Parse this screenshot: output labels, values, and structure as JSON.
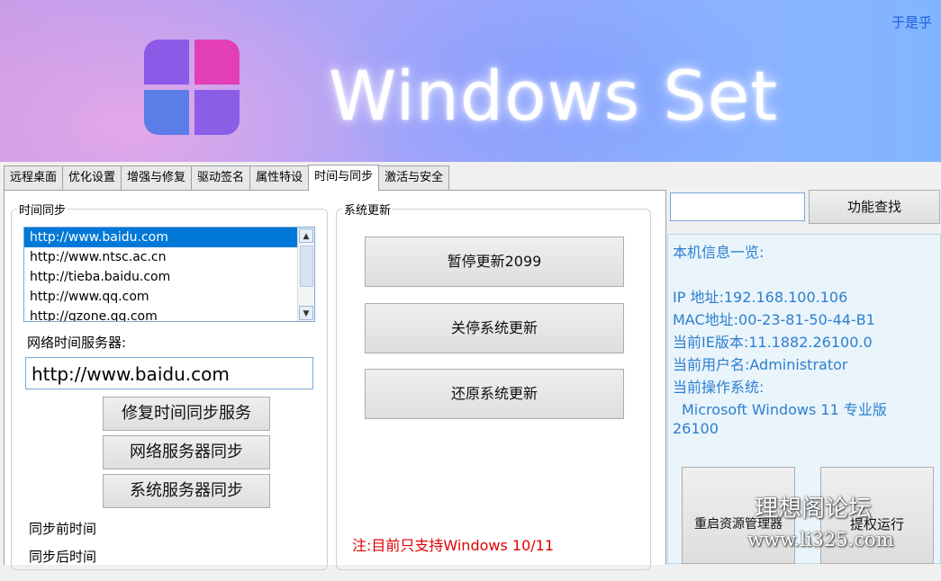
{
  "app": {
    "title": "Windows Set",
    "top_link": "于是乎"
  },
  "tabs": [
    {
      "label": "远程桌面"
    },
    {
      "label": "优化设置"
    },
    {
      "label": "增强与修复"
    },
    {
      "label": "驱动签名"
    },
    {
      "label": "属性特设"
    },
    {
      "label": "时间与同步",
      "active": true
    },
    {
      "label": "激活与安全"
    }
  ],
  "time_sync": {
    "group_title": "时间同步",
    "servers": [
      "http://www.baidu.com",
      "http://www.ntsc.ac.cn",
      "http://tieba.baidu.com",
      "http://www.qq.com",
      "http://qzone.qq.com"
    ],
    "selected_index": 0,
    "server_label": "网络时间服务器:",
    "server_value": "http://www.baidu.com",
    "btn_repair": "修复时间同步服务",
    "btn_network_sync": "网络服务器同步",
    "btn_system_sync": "系统服务器同步",
    "before_label": "同步前时间",
    "after_label": "同步后时间"
  },
  "system_update": {
    "group_title": "系统更新",
    "btn_pause": "暂停更新2099",
    "btn_disable": "关停系统更新",
    "btn_restore": "还原系统更新",
    "notice": "注:目前只支持Windows 10/11"
  },
  "search": {
    "value": "",
    "button_label": "功能查找"
  },
  "machine_info": {
    "heading": "本机信息一览:",
    "ip": "IP 地址:192.168.100.106",
    "mac": "MAC地址:00-23-81-50-44-B1",
    "ie": "当前IE版本:11.1882.26100.0",
    "user": "当前用户名:Administrator",
    "os_label": "当前操作系统:",
    "os_name": "Microsoft Windows 11 专业版",
    "os_build": "26100",
    "btn_restart_explorer": "重启资源管理器",
    "btn_elevate": "提权运行"
  },
  "watermark": {
    "line1": "理想阁论坛",
    "line2": "www.li325.com"
  },
  "colors": {
    "accent": "#0078d7",
    "info_text": "#2b7fd0",
    "notice": "#e00000"
  }
}
